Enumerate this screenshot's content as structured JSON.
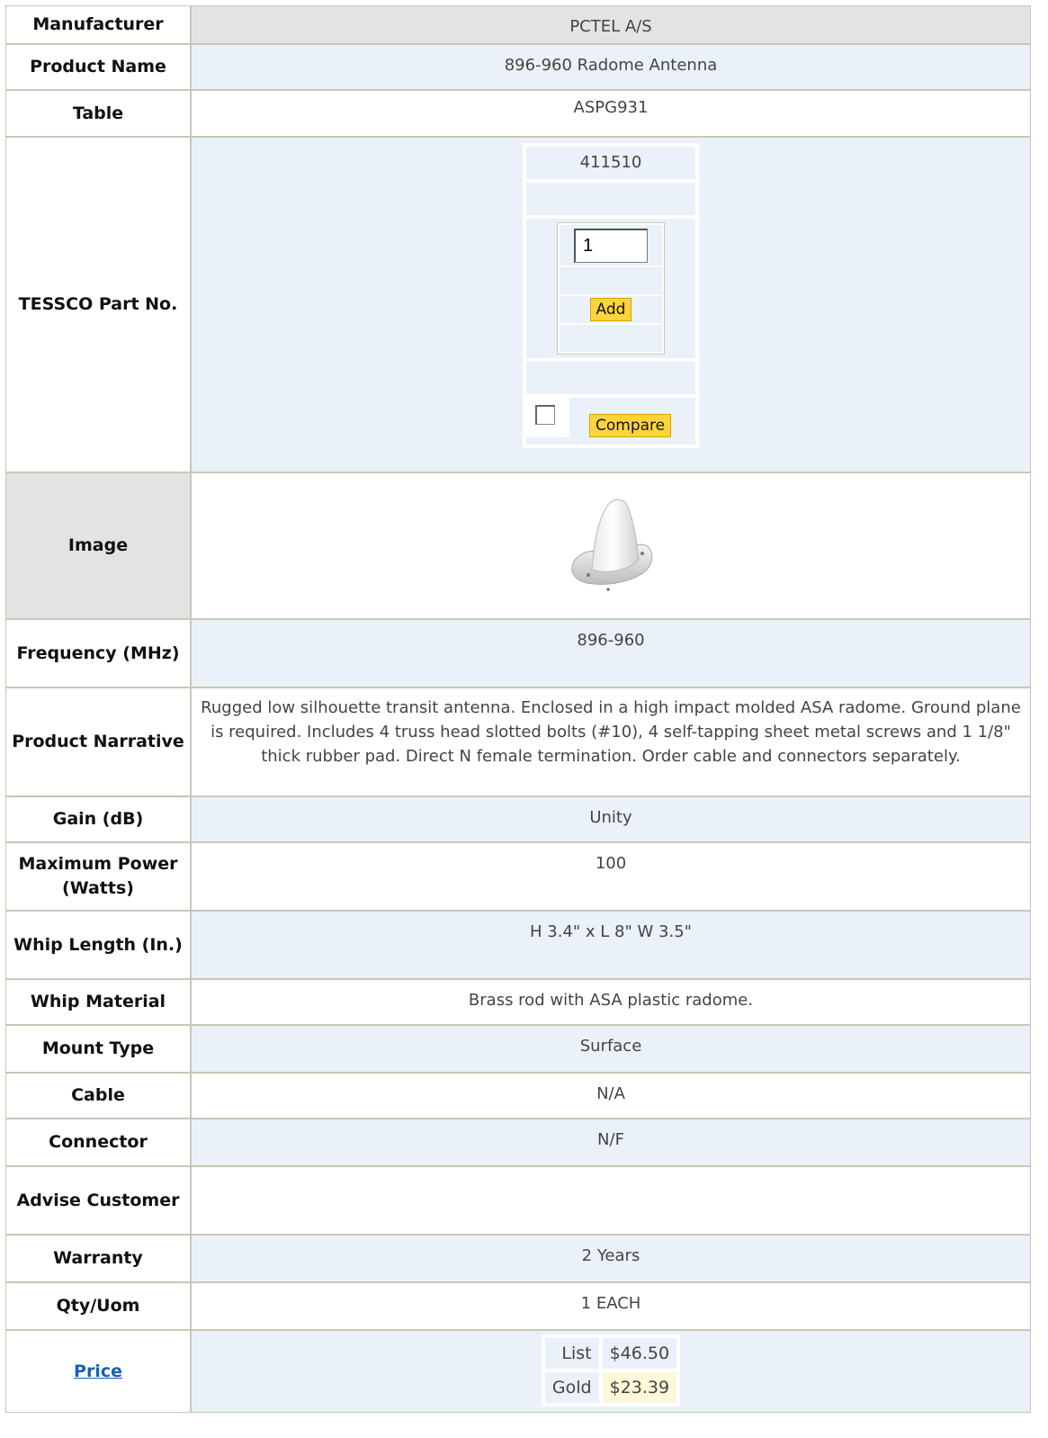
{
  "manufacturer": {
    "label": "Manufacturer",
    "value": "PCTEL A/S"
  },
  "product_name": {
    "label": "Product Name",
    "value": "896-960 Radome Antenna"
  },
  "table": {
    "label": "Table",
    "value": "ASPG931"
  },
  "part": {
    "label": "TESSCO Part No.",
    "number": "411510",
    "qty_value": "1",
    "add_label": "Add",
    "compare_label": "Compare"
  },
  "image": {
    "label": "Image",
    "icon": "radome-antenna-image"
  },
  "frequency": {
    "label": "Frequency (MHz)",
    "value": "896-960"
  },
  "narrative": {
    "label": "Product Narrative",
    "value": "Rugged low silhouette transit antenna. Enclosed in a high impact molded ASA radome. Ground plane is required. Includes 4 truss head slotted bolts (#10), 4 self-tapping sheet metal screws and 1 1/8\" thick rubber pad. Direct N female termination. Order cable and connectors separately."
  },
  "gain": {
    "label": "Gain (dB)",
    "value": "Unity"
  },
  "max_power": {
    "label": "Maximum Power (Watts)",
    "value": "100"
  },
  "whip_length": {
    "label": "Whip Length (In.)",
    "value": "H 3.4\" x L 8\" W 3.5\""
  },
  "whip_material": {
    "label": "Whip Material",
    "value": "Brass rod with ASA plastic radome."
  },
  "mount_type": {
    "label": "Mount Type",
    "value": "Surface"
  },
  "cable": {
    "label": "Cable",
    "value": "N/A"
  },
  "connector": {
    "label": "Connector",
    "value": "N/F"
  },
  "advise": {
    "label": "Advise Customer",
    "value": ""
  },
  "warranty": {
    "label": "Warranty",
    "value": "2 Years"
  },
  "qty_uom": {
    "label": "Qty/Uom",
    "value": "1 EACH"
  },
  "price": {
    "label": "Price",
    "list_label": "List",
    "list_value": "$46.50",
    "gold_label": "Gold",
    "gold_value": "$23.39"
  },
  "colors": {
    "label_border": "#c9c7b5",
    "row_blue": "#eaf1f8",
    "button_yellow": "#ffd43b",
    "link": "#1a5fb4"
  }
}
